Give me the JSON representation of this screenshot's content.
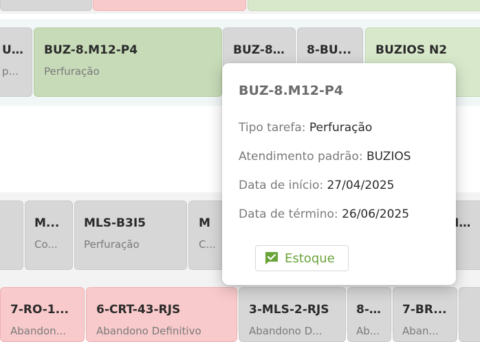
{
  "colors": {
    "green_card": "#c7dbb8",
    "gray_card": "#d7d7d7",
    "pink_card": "#f9cacb",
    "accent_green": "#6aa33a"
  },
  "row_a": {
    "cards": [
      {
        "title": "U...",
        "subtitle": "p..."
      },
      {
        "title": "BUZ-8.M12-P4",
        "subtitle": "Perfuração"
      },
      {
        "title": "BUZ-8...",
        "subtitle": ""
      },
      {
        "title": "8-BU...",
        "subtitle": ""
      },
      {
        "title": "BUZIOS N2",
        "subtitle": ""
      }
    ]
  },
  "row_b": {
    "cards": [
      {
        "title": "",
        "subtitle": ""
      },
      {
        "title": "M...",
        "subtitle": "Co..."
      },
      {
        "title": "MLS-B3I5",
        "subtitle": "Perfuração"
      },
      {
        "title": "M",
        "subtitle": "C..."
      },
      {
        "title": "I...",
        "subtitle": ""
      }
    ]
  },
  "row_c": {
    "cards": [
      {
        "title": "7-RO-1...",
        "subtitle": "Abandon..."
      },
      {
        "title": "6-CRT-43-RJS",
        "subtitle": "Abandono Definitivo"
      },
      {
        "title": "3-MLS-2-RJS",
        "subtitle": "Abandono D..."
      },
      {
        "title": "8-...",
        "subtitle": "Ab..."
      },
      {
        "title": "7-BR...",
        "subtitle": "Aban..."
      }
    ]
  },
  "popover": {
    "title": "BUZ-8.M12-P4",
    "fields": [
      {
        "label": "Tipo tarefa:",
        "value": "Perfuração"
      },
      {
        "label": "Atendimento padrão:",
        "value": "BUZIOS"
      },
      {
        "label": "Data de início:",
        "value": "27/04/2025"
      },
      {
        "label": "Data de término:",
        "value": "26/06/2025"
      }
    ],
    "button": {
      "label": "Estoque",
      "icon": "chat-check-icon"
    }
  }
}
